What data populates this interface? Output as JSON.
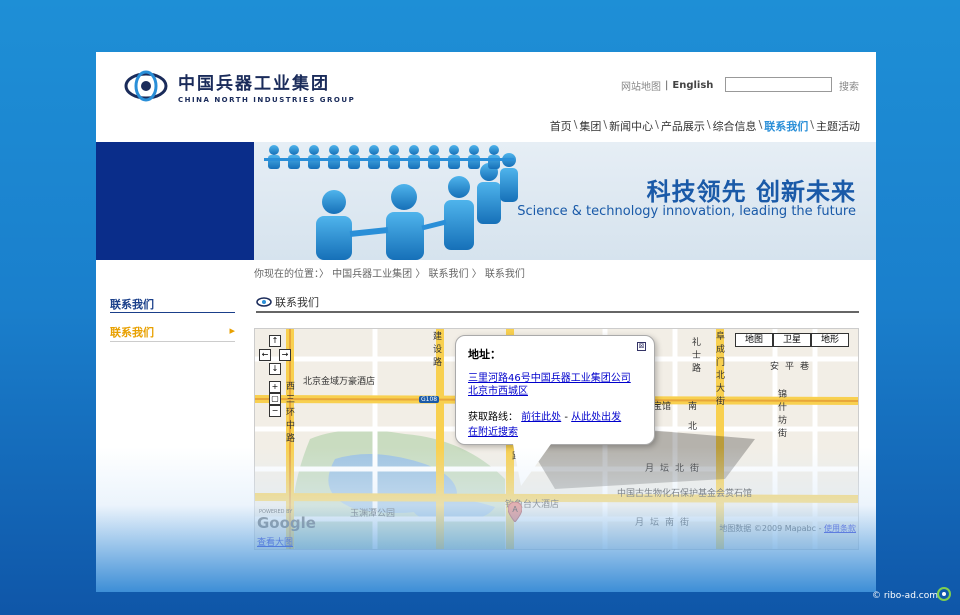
{
  "logo": {
    "cn": "中国兵器工业集团",
    "en": "CHINA NORTH INDUSTRIES GROUP"
  },
  "toplinks": {
    "sitemap": "网站地图",
    "english": "English",
    "search_button": "搜索",
    "search_placeholder": ""
  },
  "nav": {
    "items": [
      "首页",
      "集团",
      "新闻中心",
      "产品展示",
      "综合信息",
      "联系我们",
      "主题活动"
    ],
    "separator": "\\",
    "active": "联系我们"
  },
  "banner": {
    "cn": "科技领先  创新未来",
    "en": "Science & technology innovation, leading the future"
  },
  "breadcrumb": "你现在的位置：〉 中国兵器工业集团 〉 联系我们 〉 联系我们",
  "sidebar": {
    "title": "联系我们",
    "item": "联系我们",
    "arrow": "▸"
  },
  "content": {
    "title": "联系我们"
  },
  "map": {
    "types": [
      "地图",
      "卫星",
      "地形"
    ],
    "popup": {
      "title": "地址：",
      "address1": "三里河路46号中国兵器工业集团公司",
      "address2": "北京市西城区",
      "directions_label": "获取路线：",
      "to_here": "前往此处",
      "dash": " - ",
      "from_here": "从此处出发",
      "search_nearby": "在附近搜索",
      "close": "⊠"
    },
    "labels": {
      "hotel": "北京金域万豪酒店",
      "road_west_cn": "西三环中路",
      "jiangshe": "建设路",
      "lichengbei": "礼士路",
      "yuetanbei": "月坛北街",
      "yuetannan": "月坛南街",
      "fossil": "中国古生物化石保护基金会赏石馆",
      "diaoyutai": "钓鱼台大酒店",
      "yuyuantan": "玉渊潭公园",
      "baozhuang": "宝馆",
      "anping": "安平巷",
      "fuchengmen": "阜成门北大街",
      "xiangshan": "锦什坊街",
      "g108": "G108",
      "road_xi": "路",
      "south": "南",
      "north": "北"
    },
    "powered_by": "POWERED BY",
    "google": "Google",
    "view_large": "查看大图",
    "map_data": "地图数据",
    "copyright": "©2009 Mapabc - ",
    "terms": "使用条款",
    "marker_letter": "A"
  },
  "watermark": "© ribo-ad.com",
  "colors": {
    "accent": "#2a8fd8",
    "navy": "#0a2d8a",
    "sidebar_active": "#e8a000",
    "link": "#0000cc"
  }
}
